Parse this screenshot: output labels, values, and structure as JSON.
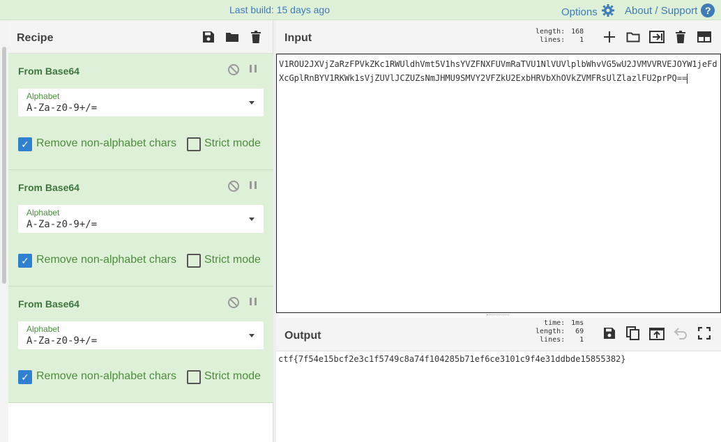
{
  "banner": {
    "build": "Last build: 15 days ago",
    "options": "Options",
    "about": "About / Support",
    "options_icon": "gear-icon",
    "about_icon": "question-circle-icon"
  },
  "recipe": {
    "title": "Recipe",
    "save_icon": "save-icon",
    "load_icon": "folder-icon",
    "clear_icon": "trash-icon",
    "operations": [
      {
        "name": "From Base64",
        "alphabet_label": "Alphabet",
        "alphabet_value": "A-Za-z0-9+/=",
        "remove_label": "Remove non-alphabet chars",
        "remove_checked": true,
        "strict_label": "Strict mode",
        "strict_checked": false
      },
      {
        "name": "From Base64",
        "alphabet_label": "Alphabet",
        "alphabet_value": "A-Za-z0-9+/=",
        "remove_label": "Remove non-alphabet chars",
        "remove_checked": true,
        "strict_label": "Strict mode",
        "strict_checked": false
      },
      {
        "name": "From Base64",
        "alphabet_label": "Alphabet",
        "alphabet_value": "A-Za-z0-9+/=",
        "remove_label": "Remove non-alphabet chars",
        "remove_checked": true,
        "strict_label": "Strict mode",
        "strict_checked": false
      }
    ]
  },
  "input": {
    "title": "Input",
    "length_label": "length:",
    "length_value": "168",
    "lines_label": "lines:",
    "lines_value": "1",
    "text": "V1ROU2JXVjZaRzFPVkZKc1RWUldhVmt5V1hsYVZFNXFUVmRaTVU1NlVUVlplbWhvVG5wU2JVMVVRVEJOYW1jeFdXcGplRnBYV1RKWk1sVjZUVlJCZUZsNmJHMU9SMVY2VFZkU2ExbHRVbXhOVkZVMFRsUlZlazlFU2prPQ==",
    "toolbar_icons": [
      "plus-icon",
      "folder-icon",
      "import-icon",
      "trash-icon",
      "layout-icon"
    ]
  },
  "output": {
    "title": "Output",
    "time_label": "time:",
    "time_value": "1ms",
    "length_label": "length:",
    "length_value": "69",
    "lines_label": "lines:",
    "lines_value": "1",
    "text": "ctf{7f54e15bcf2e3c1f5749c8a74f104285b71ef6ce3101c9f4e31ddbde15855382}",
    "toolbar_icons": [
      "save-icon",
      "copy-icon",
      "replace-input-icon",
      "undo-icon",
      "fullscreen-icon"
    ]
  }
}
